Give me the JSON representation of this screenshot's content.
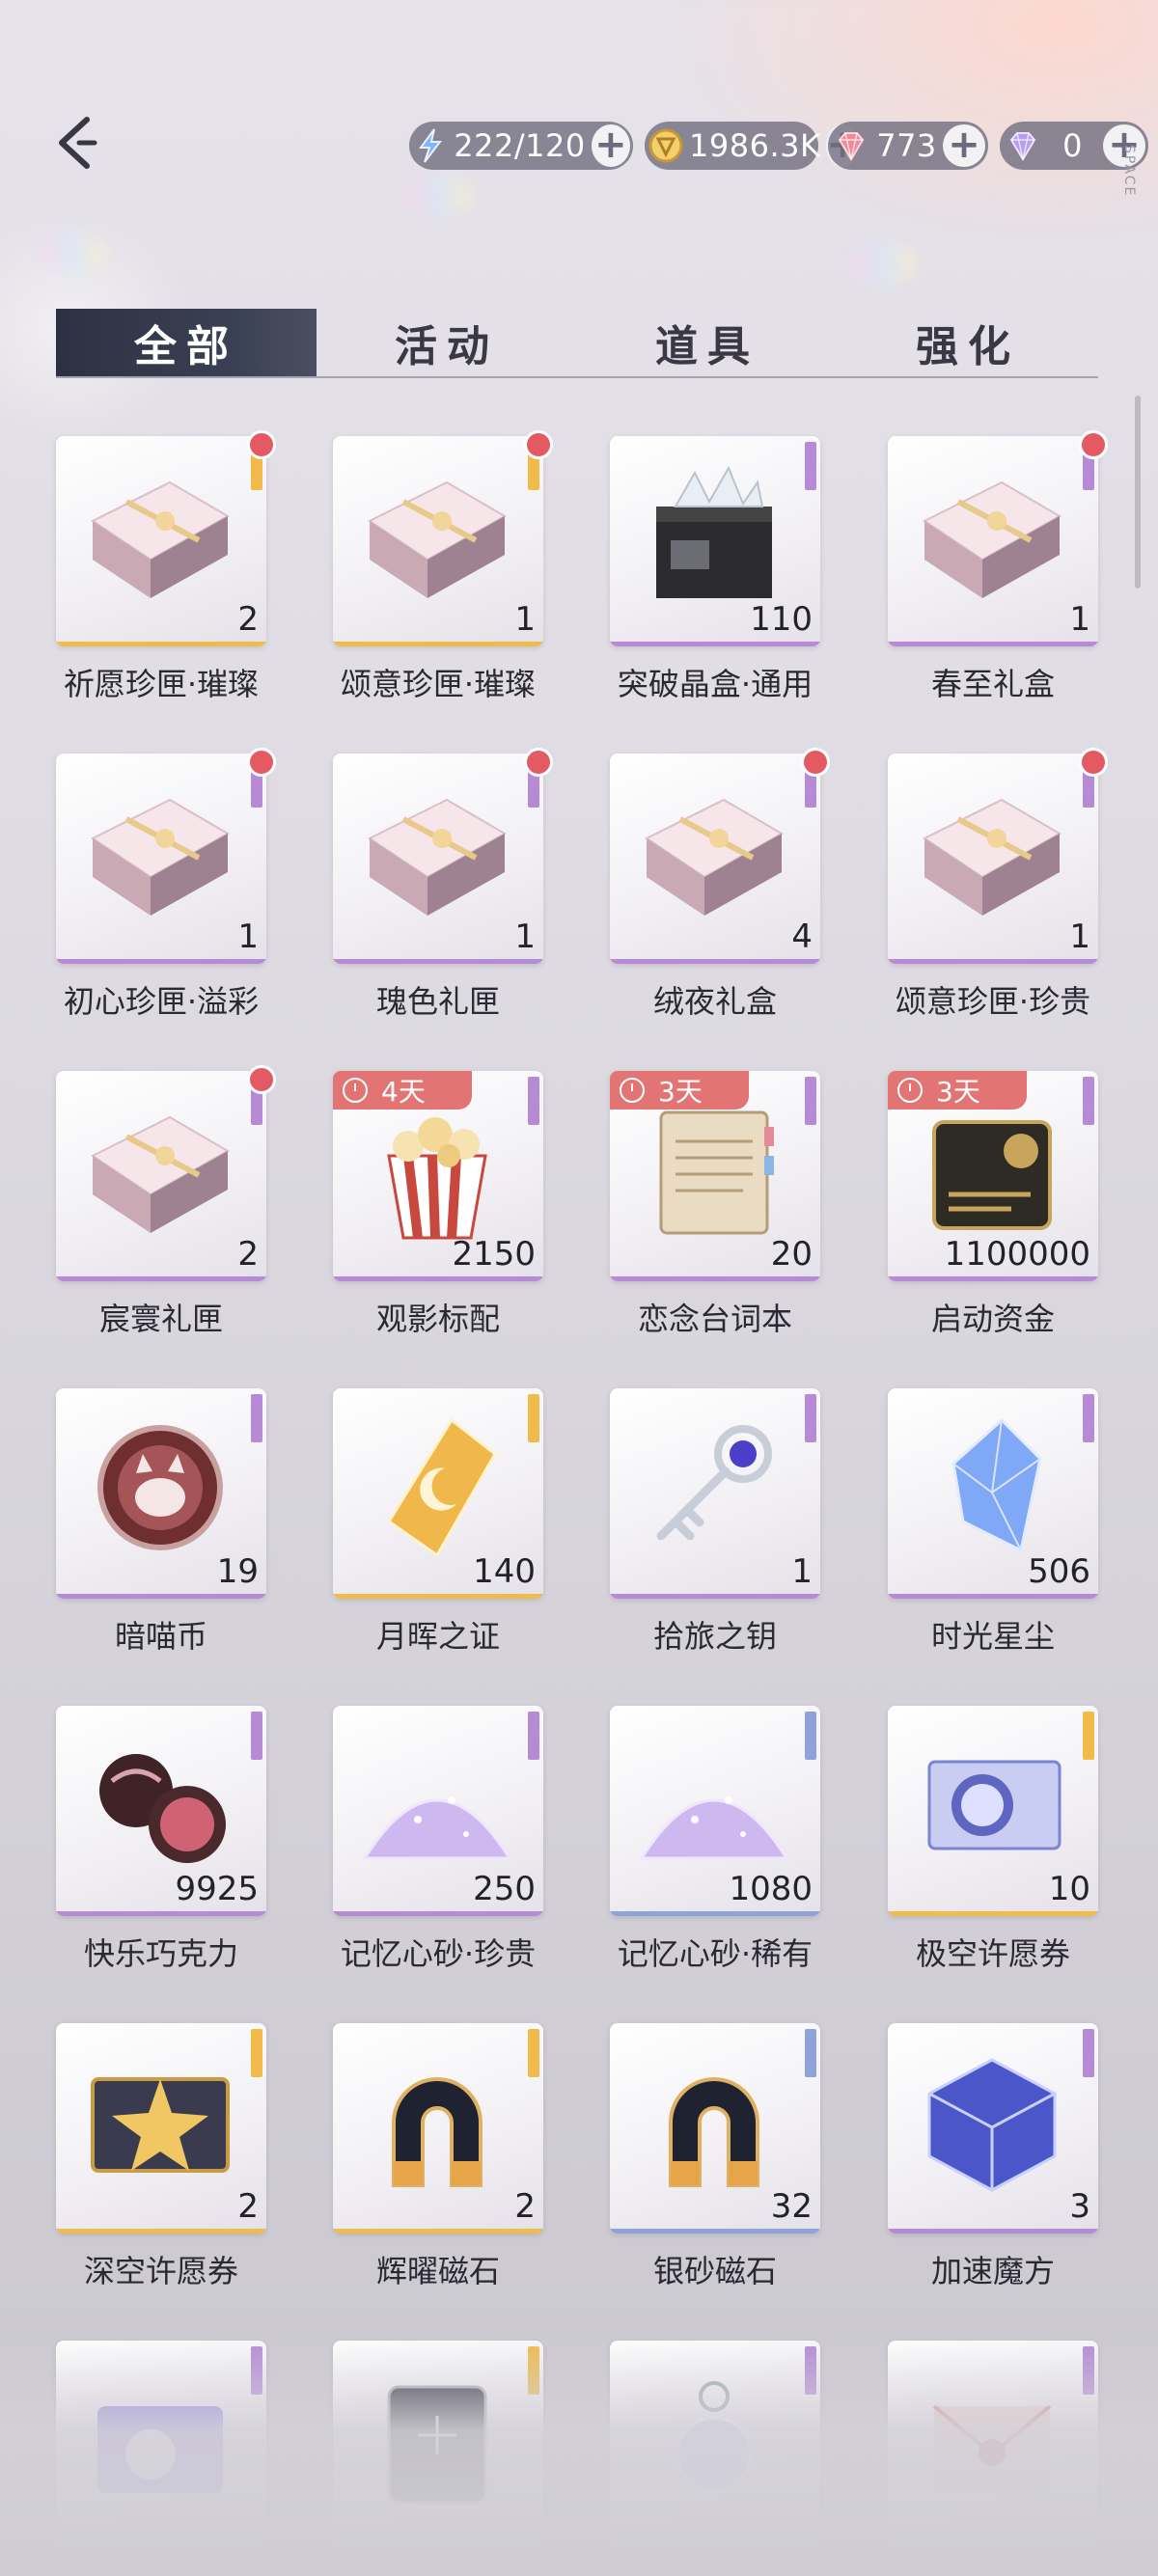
{
  "header": {
    "brand_vertical": "SPACE",
    "resources": [
      {
        "icon": "stamina-icon",
        "value": "222/120"
      },
      {
        "icon": "gold-coin-icon",
        "value": "1986.3K"
      },
      {
        "icon": "red-diamond-icon",
        "value": "773"
      },
      {
        "icon": "purple-diamond-icon",
        "value": "0"
      }
    ]
  },
  "tabs": [
    {
      "label": "全部"
    },
    {
      "label": "活动"
    },
    {
      "label": "道具"
    },
    {
      "label": "强化"
    }
  ],
  "colors": {
    "rarity_gold": "#f0bb4a",
    "rarity_purple": "#b78ad6",
    "rarity_blue": "#8fa3d8",
    "red_dot": "#e35a63",
    "timer": "#e37474",
    "tab_active": "#2c3142"
  },
  "items": [
    {
      "name": "祈愿珍匣·璀璨",
      "qty": "2",
      "rarity": "gold",
      "dot": true,
      "icon": "gift-box-icon"
    },
    {
      "name": "颂意珍匣·璀璨",
      "qty": "1",
      "rarity": "gold",
      "dot": true,
      "icon": "gift-box-icon"
    },
    {
      "name": "突破晶盒·通用",
      "qty": "110",
      "rarity": "purple",
      "dot": false,
      "icon": "crystal-box-icon"
    },
    {
      "name": "春至礼盒",
      "qty": "1",
      "rarity": "purple",
      "dot": true,
      "icon": "gift-box-icon"
    },
    {
      "name": "初心珍匣·溢彩",
      "qty": "1",
      "rarity": "purple",
      "dot": true,
      "icon": "gift-box-icon"
    },
    {
      "name": "瑰色礼匣",
      "qty": "1",
      "rarity": "purple",
      "dot": true,
      "icon": "gift-box-icon"
    },
    {
      "name": "绒夜礼盒",
      "qty": "4",
      "rarity": "purple",
      "dot": true,
      "icon": "gift-box-icon"
    },
    {
      "name": "颂意珍匣·珍贵",
      "qty": "1",
      "rarity": "purple",
      "dot": true,
      "icon": "gift-box-icon"
    },
    {
      "name": "宸寰礼匣",
      "qty": "2",
      "rarity": "purple",
      "dot": true,
      "icon": "gift-box-icon"
    },
    {
      "name": "观影标配",
      "qty": "2150",
      "rarity": "purple",
      "dot": false,
      "timer": "4天",
      "icon": "popcorn-icon"
    },
    {
      "name": "恋念台词本",
      "qty": "20",
      "rarity": "purple",
      "dot": false,
      "timer": "3天",
      "icon": "script-book-icon"
    },
    {
      "name": "启动资金",
      "qty": "1100000",
      "rarity": "purple",
      "dot": false,
      "timer": "3天",
      "icon": "money-card-icon"
    },
    {
      "name": "暗喵币",
      "qty": "19",
      "rarity": "purple",
      "dot": false,
      "icon": "cat-coin-icon"
    },
    {
      "name": "月晖之证",
      "qty": "140",
      "rarity": "gold",
      "dot": false,
      "icon": "moon-badge-icon"
    },
    {
      "name": "拾旅之钥",
      "qty": "1",
      "rarity": "purple",
      "dot": false,
      "icon": "key-icon"
    },
    {
      "name": "时光星尘",
      "qty": "506",
      "rarity": "purple",
      "dot": false,
      "icon": "crystal-icon"
    },
    {
      "name": "快乐巧克力",
      "qty": "9925",
      "rarity": "purple",
      "dot": false,
      "icon": "chocolate-icon"
    },
    {
      "name": "记忆心砂·珍贵",
      "qty": "250",
      "rarity": "purple",
      "dot": false,
      "icon": "sand-pile-icon"
    },
    {
      "name": "记忆心砂·稀有",
      "qty": "1080",
      "rarity": "blue",
      "dot": false,
      "icon": "sand-pile-icon"
    },
    {
      "name": "极空许愿券",
      "qty": "10",
      "rarity": "gold",
      "dot": false,
      "icon": "ticket-icon"
    },
    {
      "name": "深空许愿券",
      "qty": "2",
      "rarity": "gold",
      "dot": false,
      "icon": "star-ticket-icon"
    },
    {
      "name": "辉曜磁石",
      "qty": "2",
      "rarity": "gold",
      "dot": false,
      "icon": "magnet-icon"
    },
    {
      "name": "银砂磁石",
      "qty": "32",
      "rarity": "blue",
      "dot": false,
      "icon": "magnet-icon"
    },
    {
      "name": "加速魔方",
      "qty": "3",
      "rarity": "purple",
      "dot": false,
      "icon": "cube-icon"
    },
    {
      "name": "",
      "qty": "",
      "rarity": "purple",
      "dot": false,
      "icon": "card-icon"
    },
    {
      "name": "",
      "qty": "",
      "rarity": "gold",
      "dot": false,
      "icon": "tablet-icon"
    },
    {
      "name": "",
      "qty": "",
      "rarity": "purple",
      "dot": false,
      "icon": "pendant-icon"
    },
    {
      "name": "",
      "qty": "",
      "rarity": "purple",
      "dot": false,
      "icon": "envelope-icon"
    }
  ]
}
